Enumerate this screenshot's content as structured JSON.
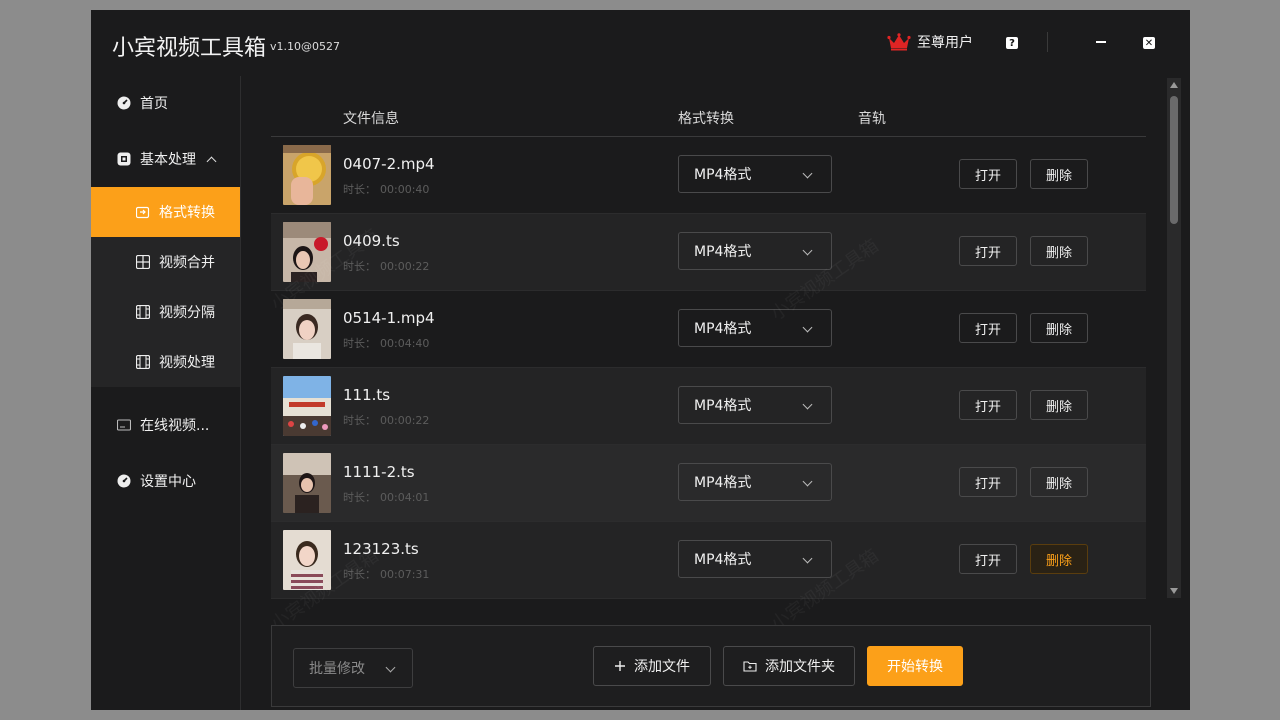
{
  "app": {
    "title": "小宾视频工具箱",
    "version": "v1.10@0527"
  },
  "titlebar": {
    "vip_label": "至尊用户",
    "help_icon": "?",
    "close_icon": "✕"
  },
  "sidebar": {
    "home": "首页",
    "basic": "基本处理",
    "sub": [
      "格式转换",
      "视频合并",
      "视频分隔",
      "视频处理"
    ],
    "online": "在线视频...",
    "settings": "设置中心"
  },
  "table": {
    "headers": {
      "file": "文件信息",
      "format": "格式转换",
      "audio": "音轨"
    },
    "duration_label": "时长：",
    "open_label": "打开",
    "delete_label": "删除",
    "rows": [
      {
        "name": "0407-2.mp4",
        "duration": "00:00:40",
        "format": "MP4格式"
      },
      {
        "name": "0409.ts",
        "duration": "00:00:22",
        "format": "MP4格式"
      },
      {
        "name": "0514-1.mp4",
        "duration": "00:04:40",
        "format": "MP4格式"
      },
      {
        "name": "111.ts",
        "duration": "00:00:22",
        "format": "MP4格式"
      },
      {
        "name": "1111-2.ts",
        "duration": "00:04:01",
        "format": "MP4格式"
      },
      {
        "name": "123123.ts",
        "duration": "00:07:31",
        "format": "MP4格式"
      }
    ]
  },
  "footer": {
    "batch_label": "批量修改",
    "add_file": "添加文件",
    "add_folder": "添加文件夹",
    "start": "开始转换"
  },
  "watermark": "小宾视频工具箱",
  "colors": {
    "accent": "#fca019",
    "bg": "#1b1b1c"
  }
}
